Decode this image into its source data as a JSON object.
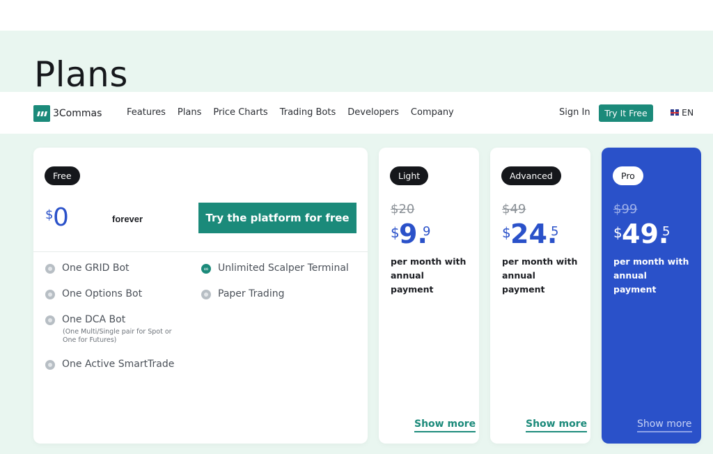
{
  "page": {
    "title": "Plans"
  },
  "nav": {
    "logo_text": "3Commas",
    "links": [
      "Features",
      "Plans",
      "Price Charts",
      "Trading Bots",
      "Developers",
      "Company"
    ],
    "sign_in": "Sign In",
    "try_free": "Try It Free",
    "language": "EN"
  },
  "plans": {
    "free": {
      "badge": "Free",
      "currency": "$",
      "price": "0",
      "period": "forever",
      "cta": "Try the platform for free",
      "features": [
        {
          "label": "One GRID Bot",
          "note": ""
        },
        {
          "label": "One Options Bot",
          "note": ""
        },
        {
          "label": "One DCA Bot",
          "note": "(One Multi/Single pair for Spot or One for Futures)"
        },
        {
          "label": "One Active SmartTrade",
          "note": ""
        },
        {
          "label": "Unlimited Scalper Terminal",
          "note": ""
        },
        {
          "label": "Paper Trading",
          "note": ""
        }
      ]
    },
    "light": {
      "badge": "Light",
      "old_price": "$20",
      "currency": "$",
      "price": "9.",
      "fraction": "9",
      "description": "per month with annual payment",
      "show_more": "Show more"
    },
    "advanced": {
      "badge": "Advanced",
      "old_price": "$49",
      "currency": "$",
      "price": "24.",
      "fraction": "5",
      "description": "per month with annual payment",
      "show_more": "Show more"
    },
    "pro": {
      "badge": "Pro",
      "old_price": "$99",
      "currency": "$",
      "price": "49.",
      "fraction": "5",
      "description": "per month with annual payment",
      "show_more": "Show more"
    }
  },
  "colors": {
    "accent_teal": "#1b8a7a",
    "brand_blue": "#2a51c9",
    "background_mint": "#e9f6f0"
  }
}
